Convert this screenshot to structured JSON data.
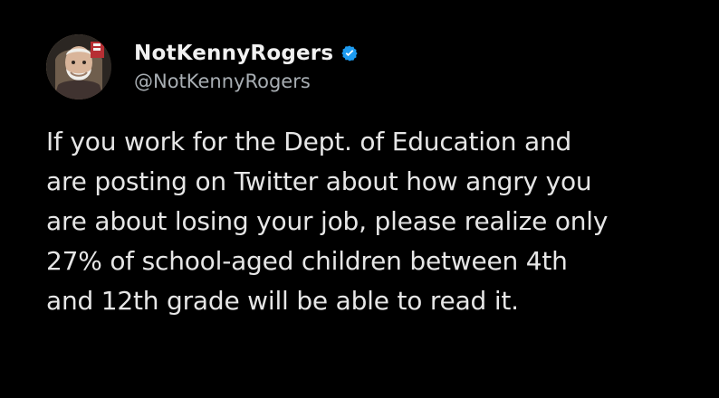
{
  "tweet": {
    "author": {
      "display_name": "NotKennyRogers",
      "handle": "@NotKennyRogers",
      "verified": true,
      "avatar_icon": "profile-photo"
    },
    "text": "If you work for the Dept. of Education and\nare posting on Twitter about how angry you\nare about losing your job, please realize only\n27% of school-aged children between 4th\nand 12th grade will be able to read it."
  },
  "colors": {
    "background": "#000000",
    "text_primary": "#e7e9ea",
    "text_secondary": "#a8aeb3",
    "verified_badge": "#1d9bf0"
  }
}
